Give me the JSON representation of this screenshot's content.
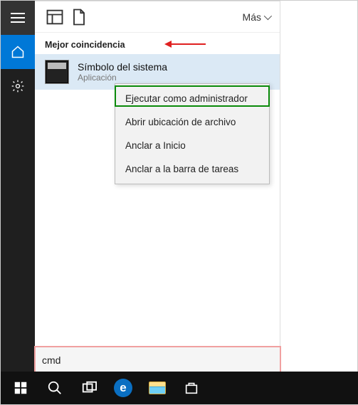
{
  "sidebar": {
    "items": [
      {
        "name": "hamburger"
      },
      {
        "name": "home"
      },
      {
        "name": "settings"
      }
    ]
  },
  "panel": {
    "mas_label": "Más",
    "section_header": "Mejor coincidencia",
    "result": {
      "title": "Símbolo del sistema",
      "subtitle": "Aplicación"
    }
  },
  "context_menu": {
    "items": [
      {
        "label": "Ejecutar como administrador"
      },
      {
        "label": "Abrir ubicación de archivo"
      },
      {
        "label": "Anclar a Inicio"
      },
      {
        "label": "Anclar a la barra de tareas"
      }
    ]
  },
  "search": {
    "value": "cmd"
  },
  "annotations": {
    "arrow_color": "#e02020",
    "highlight_color": "#0a8a0a",
    "search_outline": "#f0a0a0"
  }
}
